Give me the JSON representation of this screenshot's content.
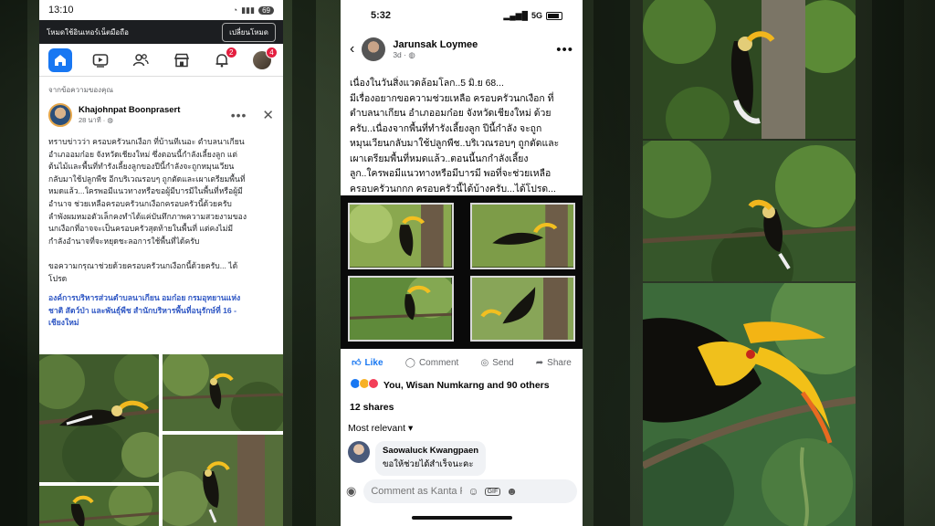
{
  "left_post": {
    "status": {
      "time": "13:10",
      "battery": "69"
    },
    "dark_mode_bar": {
      "message": "โหมดใช้อินเทอร์เน็ตมือถือ",
      "button": "เปลี่ยนโหมด"
    },
    "nav": {
      "notifications_badge": "2",
      "menu_badge": "4"
    },
    "from_label": "จากข้อความของคุณ",
    "author": "Khajohnpat Boonprasert",
    "time": "28 นาที",
    "text": "ทราบข่าวว่า ครอบครัวนกเงือก ที่บ้านทีเนอะ ตำบลนาเกียน\nอำเภออมก๋อย จังหวัดเชียงใหม่ ซึ่งตอนนี้กำลังเลี้ยงลูก แต่\nต้นไม้และพื้นที่ทำรังเลี้ยงลูกของปีนี้กำลังจะถูกหมุนเวียน\nกลับมาใช้ปลูกพืช อีกบริเวณรอบๆ ถูกตัดและเผาเตรียมพื้นที่\nหมดแล้ว...ใครพอมีแนวทางหรือขอผู้มีบารมีในพื้นที่หรือผู้มี\nอำนาจ ช่วยเหลือครอบครัวนกเงือกครอบครัวนี้ด้วยครับ\nลำพังผมหมอตัวเล็กคงทำได้แค่บันทึกภาพความสวยงามของ\nนกเงือกที่อาจจะเป็นครอบครัวสุดท้ายในพื้นที่ แต่คงไม่มี\nกำลังอำนาจที่จะหยุดชะลอการใช้พื้นที่ได้ครับ\n\nขอความกรุณาช่วยด้วยครอบครัวนกเงือกนี้ด้วยครับ... ได้\nโปรด",
    "tags": "องค์การบริหารส่วนตำบลนาเกียน อมก๋อย กรมอุทยานแห่ง\nชาติ สัตว์ป่า และพันธุ์พืช สำนักบริหารพื้นที่อนุรักษ์ที่ 16 -\nเชียงใหม่"
  },
  "middle_post": {
    "status": {
      "time": "5:32",
      "network": "5G"
    },
    "author": "Jarunsak Loymee",
    "time": "3d",
    "text": "เนื่องในวันสิ่งแวดล้อมโลก..5 มิ.ย 68...\nมีเรื่องอยากขอความช่วยเหลือ ครอบครัวนกเงือก ที่\nตำบลนาเกียน อำเภออมก๋อย จังหวัดเชียงใหม่ ด้วย\nครับ..เนื่องจากพื้นที่ทำรังเลี้ยงลูก ปีนี้กำลัง จะถูก\nหมุนเวียนกลับมาใช้ปลูกพืช..บริเวณรอบๆ ถูกตัดและ\nเผาเตรียมพื้นที่หมดแล้ว..ตอนนี้นกกำลังเลี้ยง\nลูก..ใครพอมีแนวทางหรือมีบารมี พอที่จะช่วยเหลือ\nครอบครัวนกกก ครอบครัวนี้ได้บ้างครับ...ได้โปรด...",
    "actions": {
      "like": "Like",
      "comment": "Comment",
      "send": "Send",
      "share": "Share"
    },
    "reactions": "You, Wisan Numkarng and 90 others",
    "shares": "12 shares",
    "sort": "Most relevant",
    "comment": {
      "author": "Saowaluck Kwangpaen",
      "text": "ขอให้ช่วยได้สำเร็จนะคะ"
    },
    "input_placeholder": "Comment as Kanta Poo...",
    "gif_label": "GIF"
  },
  "colors": {
    "facebook_blue": "#1877f2",
    "badge_red": "#e41e3f",
    "link_blue": "#2f57c4"
  }
}
